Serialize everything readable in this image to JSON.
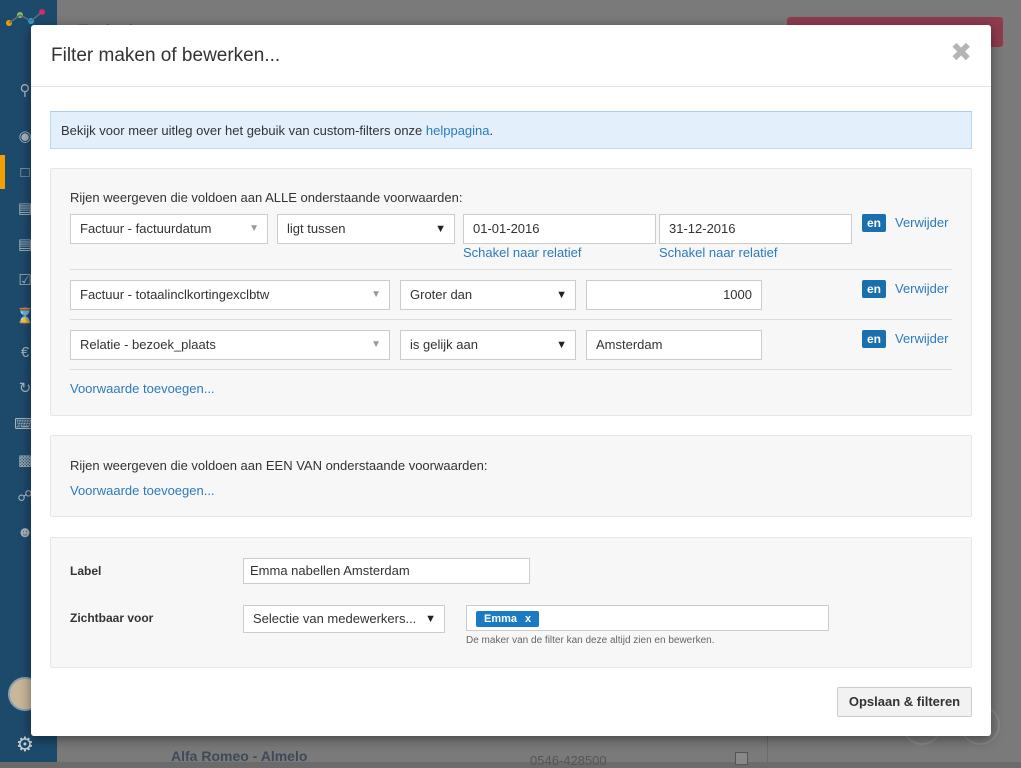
{
  "modal": {
    "title": "Filter maken of bewerken...",
    "close_symbol": "✖"
  },
  "info": {
    "text": "Bekijk voor meer uitleg over het gebuik van custom-filters onze ",
    "link": "helppagina",
    "suffix": "."
  },
  "all_conditions": {
    "heading": "Rijen weergeven die voldoen aan ALLE onderstaande voorwaarden:",
    "rows": [
      {
        "field": "Factuur - factuurdatum",
        "operator": "ligt tussen",
        "value_from": "01-01-2016",
        "value_to": "31-12-2016",
        "switch_from": "Schakel naar relatief",
        "switch_to": "Schakel naar relatief",
        "conjunction": "en",
        "remove": "Verwijder"
      },
      {
        "field": "Factuur - totaalinclkortingexclbtw",
        "operator": "Groter dan",
        "value": "1000",
        "conjunction": "en",
        "remove": "Verwijder"
      },
      {
        "field": "Relatie - bezoek_plaats",
        "operator": "is gelijk aan",
        "value": "Amsterdam",
        "conjunction": "en",
        "remove": "Verwijder"
      }
    ],
    "add_link": "Voorwaarde toevoegen..."
  },
  "any_conditions": {
    "heading": "Rijen weergeven die voldoen aan EEN VAN onderstaande voorwaarden:",
    "add_link": "Voorwaarde toevoegen..."
  },
  "settings": {
    "label_title": "Label",
    "label_value": "Emma nabellen Amsterdam",
    "visible_title": "Zichtbaar voor",
    "visible_select": "Selectie van medewerkers...",
    "tag": "Emma",
    "tag_remove": "x",
    "hint": "De maker van de filter kan deze altijd zien en bewerken."
  },
  "save_button": "Opslaan & filteren",
  "background": {
    "page_title": "Relaties",
    "row_name": "Alfa Romeo - Almelo",
    "row_phone": "0546-428500"
  },
  "colors": {
    "sidebar": "#1d4a6b",
    "accent_blue": "#1a6fae",
    "link": "#2b7bbf"
  },
  "icons": {
    "select_caret": "▼",
    "gear": "⚙"
  }
}
